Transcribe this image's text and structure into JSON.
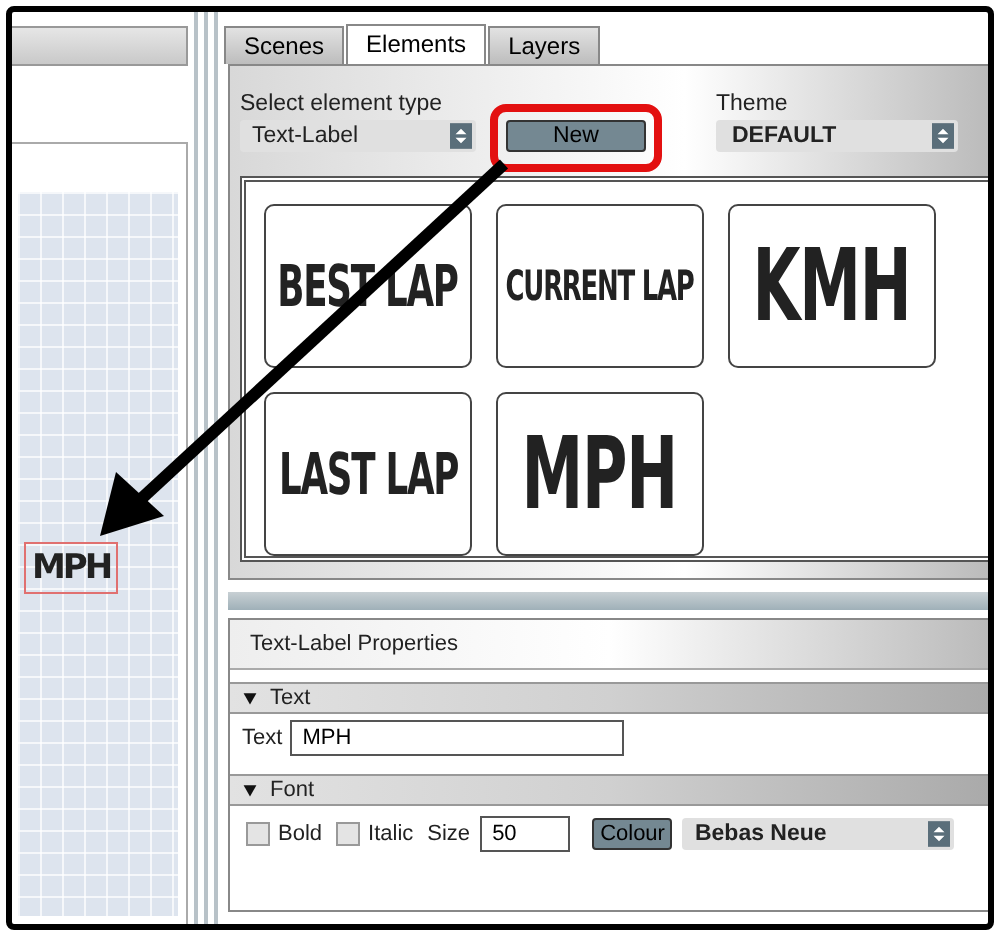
{
  "canvas": {
    "label": "MPH",
    "selected": true
  },
  "tabs": [
    {
      "label": "Scenes",
      "selected": false
    },
    {
      "label": "Elements",
      "selected": true
    },
    {
      "label": "Layers",
      "selected": false
    }
  ],
  "element_type": {
    "label": "Select element type",
    "value": "Text-Label"
  },
  "new_button": "New",
  "theme": {
    "label": "Theme",
    "value": "DEFAULT"
  },
  "elements": [
    {
      "text": "BEST LAP"
    },
    {
      "text": "CURRENT LAP"
    },
    {
      "text": "KMH"
    },
    {
      "text": "LAST LAP"
    },
    {
      "text": "MPH"
    }
  ],
  "properties": {
    "title": "Text-Label Properties",
    "sections": [
      {
        "kind": "text",
        "title": "Text",
        "expanded": true,
        "field_label": "Text",
        "value": "MPH"
      },
      {
        "kind": "font",
        "title": "Font",
        "expanded": true,
        "bold": {
          "label": "Bold",
          "checked": false
        },
        "italic": {
          "label": "Italic",
          "checked": false
        },
        "size_label": "Size",
        "size": "50",
        "colour_button": "Colour",
        "font": "Bebas Neue"
      }
    ]
  }
}
